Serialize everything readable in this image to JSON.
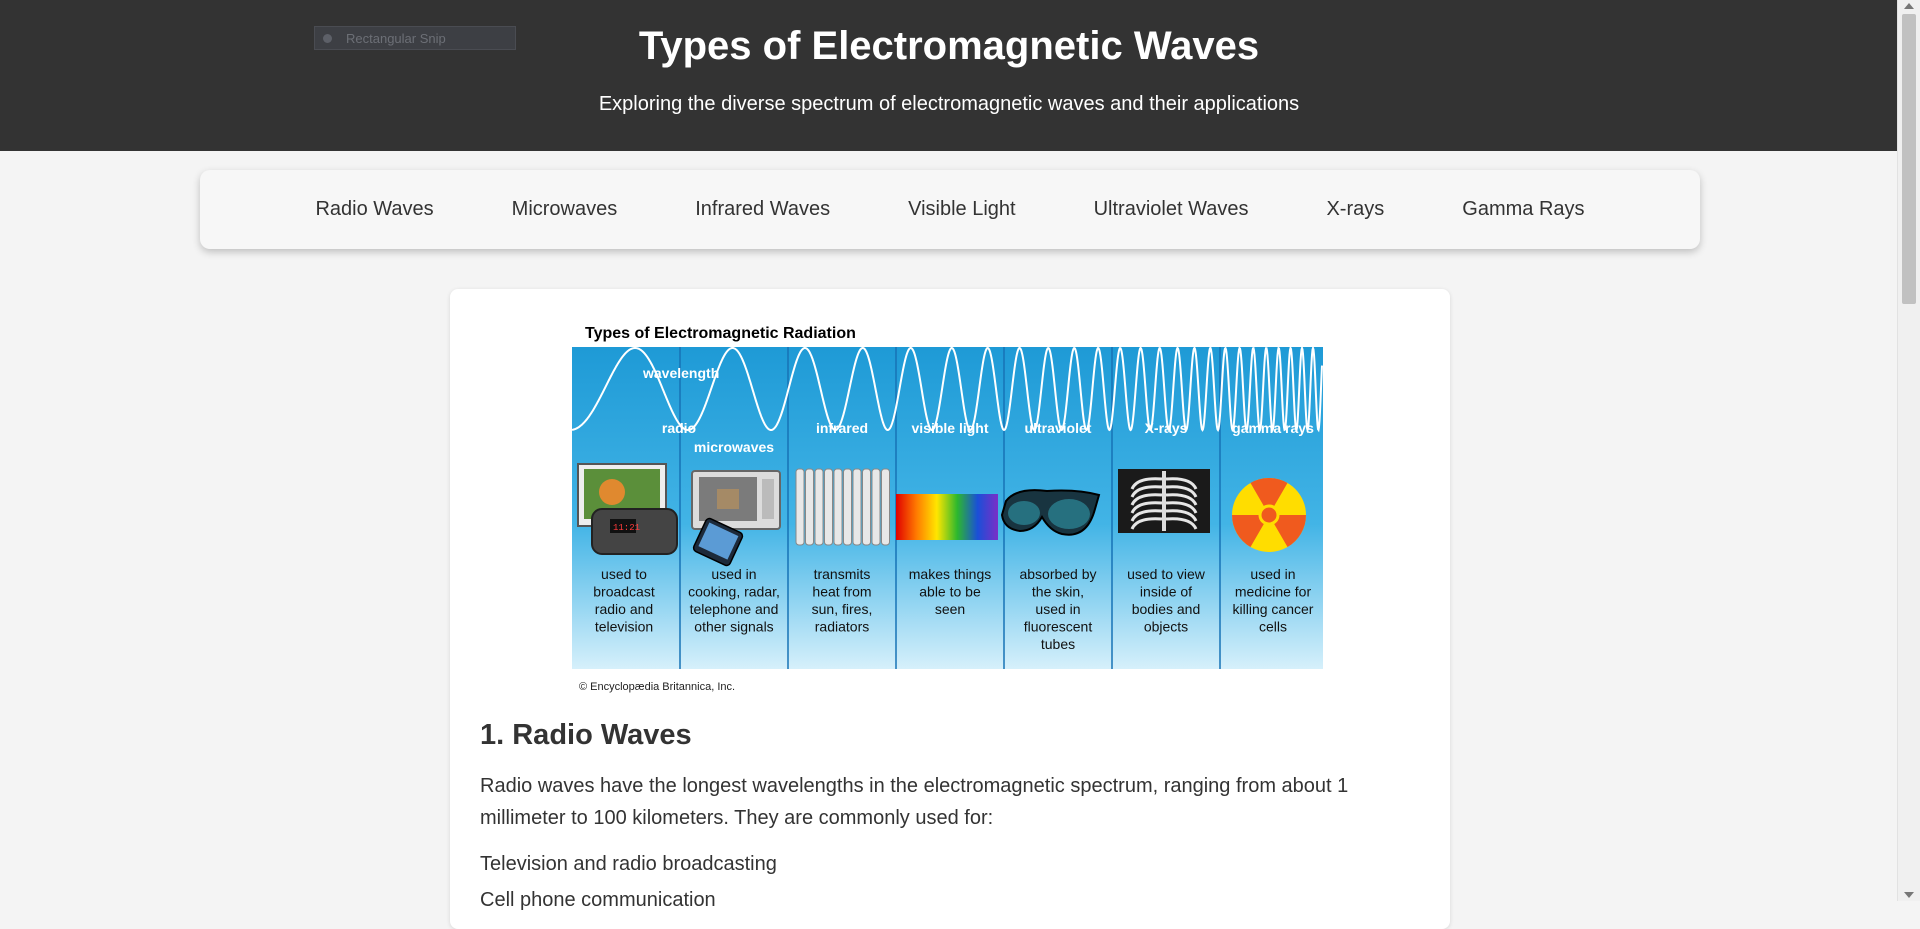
{
  "header": {
    "title": "Types of Electromagnetic Waves",
    "subtitle": "Exploring the diverse spectrum of electromagnetic waves and their applications"
  },
  "snip_overlay": {
    "label": "Rectangular Snip"
  },
  "nav": {
    "items": [
      "Radio Waves",
      "Microwaves",
      "Infrared Waves",
      "Visible Light",
      "Ultraviolet Waves",
      "X-rays",
      "Gamma Rays"
    ]
  },
  "figure": {
    "title": "Types of Electromagnetic Radiation",
    "wavelength_label": "wavelength",
    "credit": "© Encyclopædia Britannica, Inc.",
    "bands": [
      {
        "name": "radio",
        "desc": [
          "used to",
          "broadcast",
          "radio and",
          "television"
        ]
      },
      {
        "name": "microwaves",
        "desc": [
          "used in",
          "cooking, radar,",
          "telephone and",
          "other signals"
        ]
      },
      {
        "name": "infrared",
        "desc": [
          "transmits",
          "heat from",
          "sun, fires,",
          "radiators"
        ]
      },
      {
        "name": "visible light",
        "desc": [
          "makes things",
          "able to be",
          "seen"
        ]
      },
      {
        "name": "ultraviolet",
        "desc": [
          "absorbed by",
          "the skin,",
          "used in",
          "fluorescent",
          "tubes"
        ]
      },
      {
        "name": "X-rays",
        "desc": [
          "used to view",
          "inside of",
          "bodies and",
          "objects"
        ]
      },
      {
        "name": "gamma rays",
        "desc": [
          "used in",
          "medicine for",
          "killing cancer",
          "cells"
        ]
      }
    ]
  },
  "section": {
    "heading": "1. Radio Waves",
    "intro": "Radio waves have the longest wavelengths in the electromagnetic spectrum, ranging from about 1 millimeter to 100 kilometers. They are commonly used for:",
    "list": [
      "Television and radio broadcasting",
      "Cell phone communication"
    ]
  },
  "colors": {
    "header_bg": "#333333",
    "page_bg": "#f4f4f4",
    "sky_top": "#1e9ad6",
    "sky_bottom": "#d6f0fb"
  }
}
